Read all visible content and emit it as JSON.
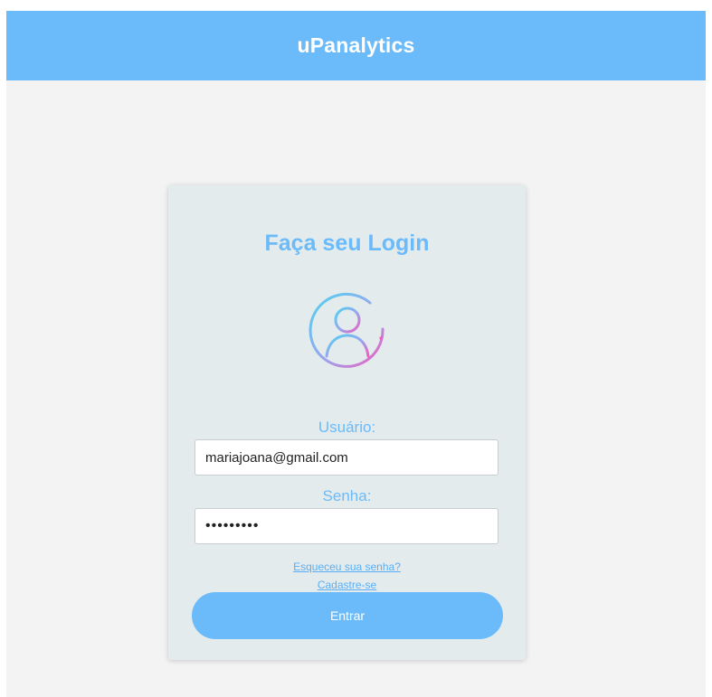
{
  "header": {
    "brand": "uPanalytics"
  },
  "login": {
    "title": "Faça seu Login",
    "avatar_icon": "user-circle-icon",
    "username_label": "Usuário:",
    "username_value": "mariajoana@gmail.com",
    "password_label": "Senha:",
    "password_value": "•••••••••",
    "forgot_link": "Esqueceu sua senha?",
    "signup_link": "Cadastre-se",
    "submit_label": "Entrar"
  },
  "colors": {
    "accent": "#6bbbfb",
    "page_background": "#f3f3f3",
    "card_background": "#e4ebec"
  }
}
